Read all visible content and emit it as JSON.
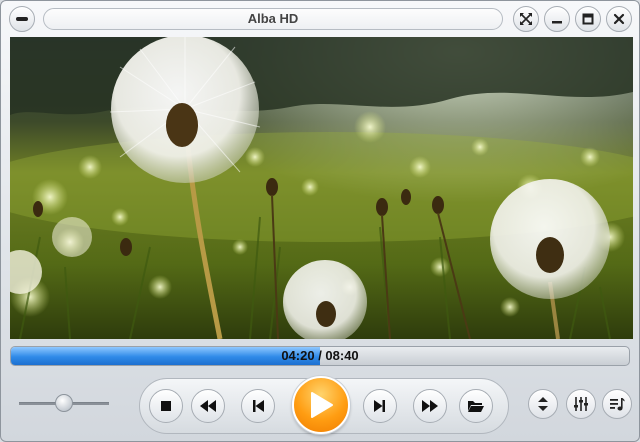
{
  "window": {
    "title": "Alba HD"
  },
  "playback": {
    "time_display": "04:20 / 08:40",
    "progress_percent": 50,
    "volume_percent": 50,
    "state": "paused"
  },
  "icons": {
    "menu": "menu-dash-icon",
    "fullscreen": "fullscreen-arrows-icon",
    "minimize": "minimize-icon",
    "maximize": "maximize-icon",
    "close": "close-icon",
    "stop": "stop-icon",
    "rewind": "rewind-icon",
    "previous": "skip-previous-icon",
    "play": "play-icon",
    "next": "skip-next-icon",
    "fast_forward": "fast-forward-icon",
    "open": "open-folder-icon",
    "updown": "up-down-icon",
    "equalizer": "equalizer-icon",
    "playlist": "playlist-icon"
  },
  "colors": {
    "accent_orange": "#ff9d12",
    "progress_blue": "#2f8ae8"
  }
}
